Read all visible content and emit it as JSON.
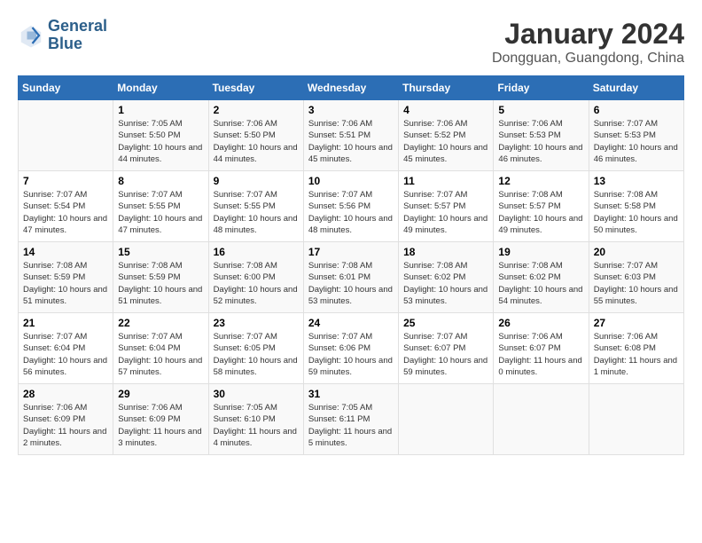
{
  "logo": {
    "line1": "General",
    "line2": "Blue"
  },
  "title": "January 2024",
  "location": "Dongguan, Guangdong, China",
  "headers": [
    "Sunday",
    "Monday",
    "Tuesday",
    "Wednesday",
    "Thursday",
    "Friday",
    "Saturday"
  ],
  "weeks": [
    [
      {
        "day": "",
        "sunrise": "",
        "sunset": "",
        "daylight": ""
      },
      {
        "day": "1",
        "sunrise": "Sunrise: 7:05 AM",
        "sunset": "Sunset: 5:50 PM",
        "daylight": "Daylight: 10 hours and 44 minutes."
      },
      {
        "day": "2",
        "sunrise": "Sunrise: 7:06 AM",
        "sunset": "Sunset: 5:50 PM",
        "daylight": "Daylight: 10 hours and 44 minutes."
      },
      {
        "day": "3",
        "sunrise": "Sunrise: 7:06 AM",
        "sunset": "Sunset: 5:51 PM",
        "daylight": "Daylight: 10 hours and 45 minutes."
      },
      {
        "day": "4",
        "sunrise": "Sunrise: 7:06 AM",
        "sunset": "Sunset: 5:52 PM",
        "daylight": "Daylight: 10 hours and 45 minutes."
      },
      {
        "day": "5",
        "sunrise": "Sunrise: 7:06 AM",
        "sunset": "Sunset: 5:53 PM",
        "daylight": "Daylight: 10 hours and 46 minutes."
      },
      {
        "day": "6",
        "sunrise": "Sunrise: 7:07 AM",
        "sunset": "Sunset: 5:53 PM",
        "daylight": "Daylight: 10 hours and 46 minutes."
      }
    ],
    [
      {
        "day": "7",
        "sunrise": "Sunrise: 7:07 AM",
        "sunset": "Sunset: 5:54 PM",
        "daylight": "Daylight: 10 hours and 47 minutes."
      },
      {
        "day": "8",
        "sunrise": "Sunrise: 7:07 AM",
        "sunset": "Sunset: 5:55 PM",
        "daylight": "Daylight: 10 hours and 47 minutes."
      },
      {
        "day": "9",
        "sunrise": "Sunrise: 7:07 AM",
        "sunset": "Sunset: 5:55 PM",
        "daylight": "Daylight: 10 hours and 48 minutes."
      },
      {
        "day": "10",
        "sunrise": "Sunrise: 7:07 AM",
        "sunset": "Sunset: 5:56 PM",
        "daylight": "Daylight: 10 hours and 48 minutes."
      },
      {
        "day": "11",
        "sunrise": "Sunrise: 7:07 AM",
        "sunset": "Sunset: 5:57 PM",
        "daylight": "Daylight: 10 hours and 49 minutes."
      },
      {
        "day": "12",
        "sunrise": "Sunrise: 7:08 AM",
        "sunset": "Sunset: 5:57 PM",
        "daylight": "Daylight: 10 hours and 49 minutes."
      },
      {
        "day": "13",
        "sunrise": "Sunrise: 7:08 AM",
        "sunset": "Sunset: 5:58 PM",
        "daylight": "Daylight: 10 hours and 50 minutes."
      }
    ],
    [
      {
        "day": "14",
        "sunrise": "Sunrise: 7:08 AM",
        "sunset": "Sunset: 5:59 PM",
        "daylight": "Daylight: 10 hours and 51 minutes."
      },
      {
        "day": "15",
        "sunrise": "Sunrise: 7:08 AM",
        "sunset": "Sunset: 5:59 PM",
        "daylight": "Daylight: 10 hours and 51 minutes."
      },
      {
        "day": "16",
        "sunrise": "Sunrise: 7:08 AM",
        "sunset": "Sunset: 6:00 PM",
        "daylight": "Daylight: 10 hours and 52 minutes."
      },
      {
        "day": "17",
        "sunrise": "Sunrise: 7:08 AM",
        "sunset": "Sunset: 6:01 PM",
        "daylight": "Daylight: 10 hours and 53 minutes."
      },
      {
        "day": "18",
        "sunrise": "Sunrise: 7:08 AM",
        "sunset": "Sunset: 6:02 PM",
        "daylight": "Daylight: 10 hours and 53 minutes."
      },
      {
        "day": "19",
        "sunrise": "Sunrise: 7:08 AM",
        "sunset": "Sunset: 6:02 PM",
        "daylight": "Daylight: 10 hours and 54 minutes."
      },
      {
        "day": "20",
        "sunrise": "Sunrise: 7:07 AM",
        "sunset": "Sunset: 6:03 PM",
        "daylight": "Daylight: 10 hours and 55 minutes."
      }
    ],
    [
      {
        "day": "21",
        "sunrise": "Sunrise: 7:07 AM",
        "sunset": "Sunset: 6:04 PM",
        "daylight": "Daylight: 10 hours and 56 minutes."
      },
      {
        "day": "22",
        "sunrise": "Sunrise: 7:07 AM",
        "sunset": "Sunset: 6:04 PM",
        "daylight": "Daylight: 10 hours and 57 minutes."
      },
      {
        "day": "23",
        "sunrise": "Sunrise: 7:07 AM",
        "sunset": "Sunset: 6:05 PM",
        "daylight": "Daylight: 10 hours and 58 minutes."
      },
      {
        "day": "24",
        "sunrise": "Sunrise: 7:07 AM",
        "sunset": "Sunset: 6:06 PM",
        "daylight": "Daylight: 10 hours and 59 minutes."
      },
      {
        "day": "25",
        "sunrise": "Sunrise: 7:07 AM",
        "sunset": "Sunset: 6:07 PM",
        "daylight": "Daylight: 10 hours and 59 minutes."
      },
      {
        "day": "26",
        "sunrise": "Sunrise: 7:06 AM",
        "sunset": "Sunset: 6:07 PM",
        "daylight": "Daylight: 11 hours and 0 minutes."
      },
      {
        "day": "27",
        "sunrise": "Sunrise: 7:06 AM",
        "sunset": "Sunset: 6:08 PM",
        "daylight": "Daylight: 11 hours and 1 minute."
      }
    ],
    [
      {
        "day": "28",
        "sunrise": "Sunrise: 7:06 AM",
        "sunset": "Sunset: 6:09 PM",
        "daylight": "Daylight: 11 hours and 2 minutes."
      },
      {
        "day": "29",
        "sunrise": "Sunrise: 7:06 AM",
        "sunset": "Sunset: 6:09 PM",
        "daylight": "Daylight: 11 hours and 3 minutes."
      },
      {
        "day": "30",
        "sunrise": "Sunrise: 7:05 AM",
        "sunset": "Sunset: 6:10 PM",
        "daylight": "Daylight: 11 hours and 4 minutes."
      },
      {
        "day": "31",
        "sunrise": "Sunrise: 7:05 AM",
        "sunset": "Sunset: 6:11 PM",
        "daylight": "Daylight: 11 hours and 5 minutes."
      },
      {
        "day": "",
        "sunrise": "",
        "sunset": "",
        "daylight": ""
      },
      {
        "day": "",
        "sunrise": "",
        "sunset": "",
        "daylight": ""
      },
      {
        "day": "",
        "sunrise": "",
        "sunset": "",
        "daylight": ""
      }
    ]
  ]
}
